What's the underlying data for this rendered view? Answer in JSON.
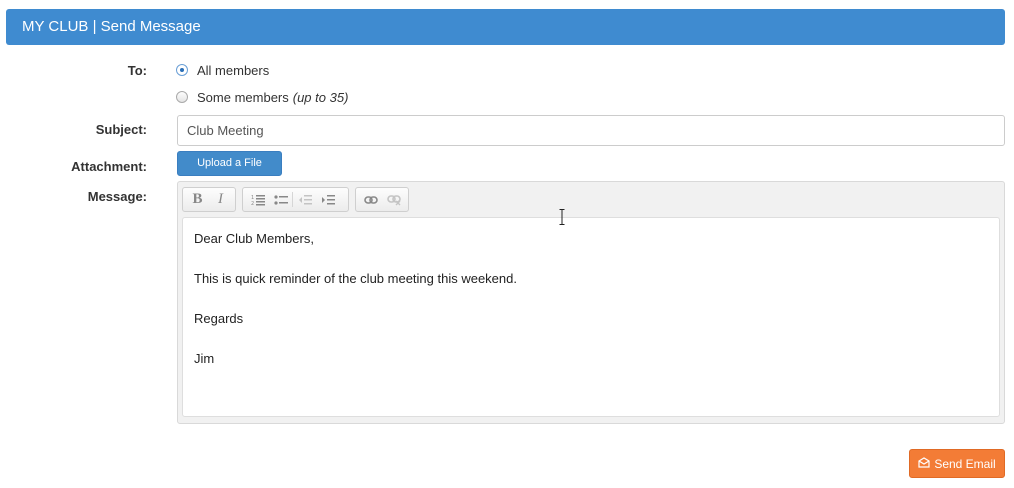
{
  "header": {
    "title": "MY CLUB | Send Message"
  },
  "form": {
    "to_label": "To:",
    "recipients": {
      "all_label": "All members",
      "some_label": "Some members",
      "some_hint": "(up to 35)",
      "selected": "All members"
    },
    "subject_label": "Subject:",
    "subject_value": "Club Meeting",
    "attachment_label": "Attachment:",
    "upload_label": "Upload a File",
    "message_label": "Message:"
  },
  "toolbar": {
    "groups": [
      {
        "buttons": [
          "bold-icon",
          "italic-icon"
        ]
      },
      {
        "buttons": [
          "numbered-list-icon",
          "bullet-list-icon",
          "outdent-icon",
          "indent-icon"
        ]
      },
      {
        "buttons": [
          "link-icon",
          "unlink-icon"
        ]
      }
    ]
  },
  "message": {
    "line1": "Dear Club Members,",
    "line2": "This is quick reminder of the club meeting this weekend.",
    "line3": "Regards",
    "line4": "Jim"
  },
  "actions": {
    "send_label": "Send Email"
  },
  "colors": {
    "header": "#3f8bd0",
    "primary_button": "#428bca",
    "send_button": "#f37c36"
  }
}
